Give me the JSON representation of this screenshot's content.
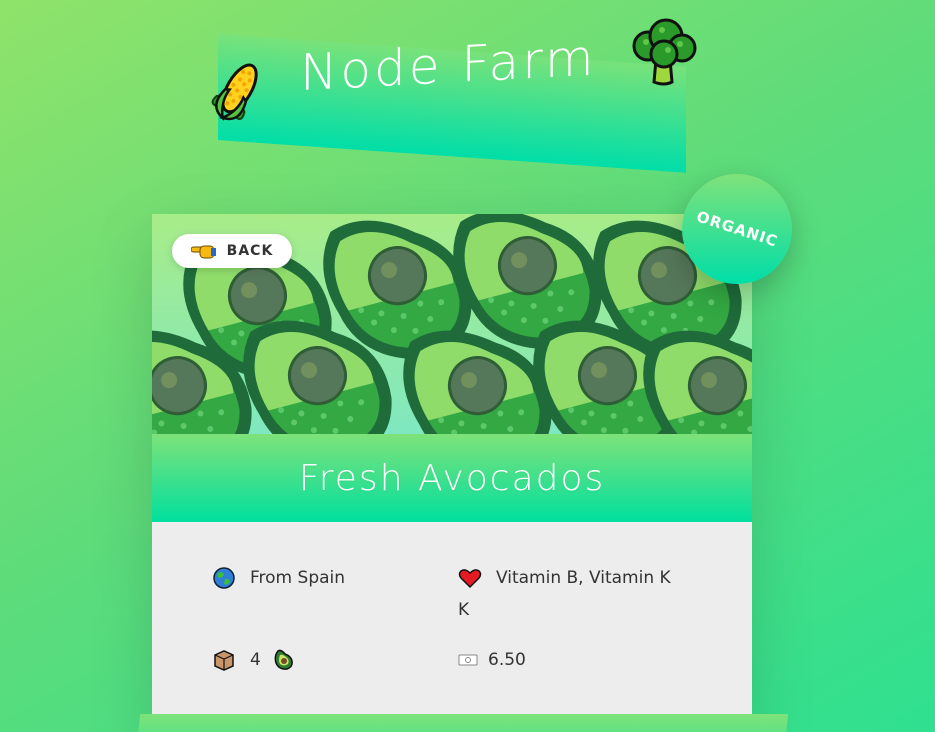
{
  "header": {
    "title": "Node Farm",
    "left_icon": "corn-icon",
    "right_icon": "broccoli-icon"
  },
  "product": {
    "back_label": "BACK",
    "back_icon": "pointing-hand-icon",
    "badge": "ORGANIC",
    "name": "Fresh Avocados",
    "image_subject": "avocado pattern",
    "origin": "From Spain",
    "origin_icon": "globe-icon",
    "nutrients": "Vitamin B, Vitamin K",
    "nutrients_overflow": "K",
    "nutrients_icon": "heart-icon",
    "quantity": "4",
    "quantity_icon": "box-icon",
    "quantity_unit_icon": "avocado-icon",
    "price": "6.50",
    "price_icon": "price-tag-icon"
  },
  "colors": {
    "accent_light": "#79e27a",
    "accent_dark": "#00dea8",
    "card_bg": "#ededed"
  }
}
